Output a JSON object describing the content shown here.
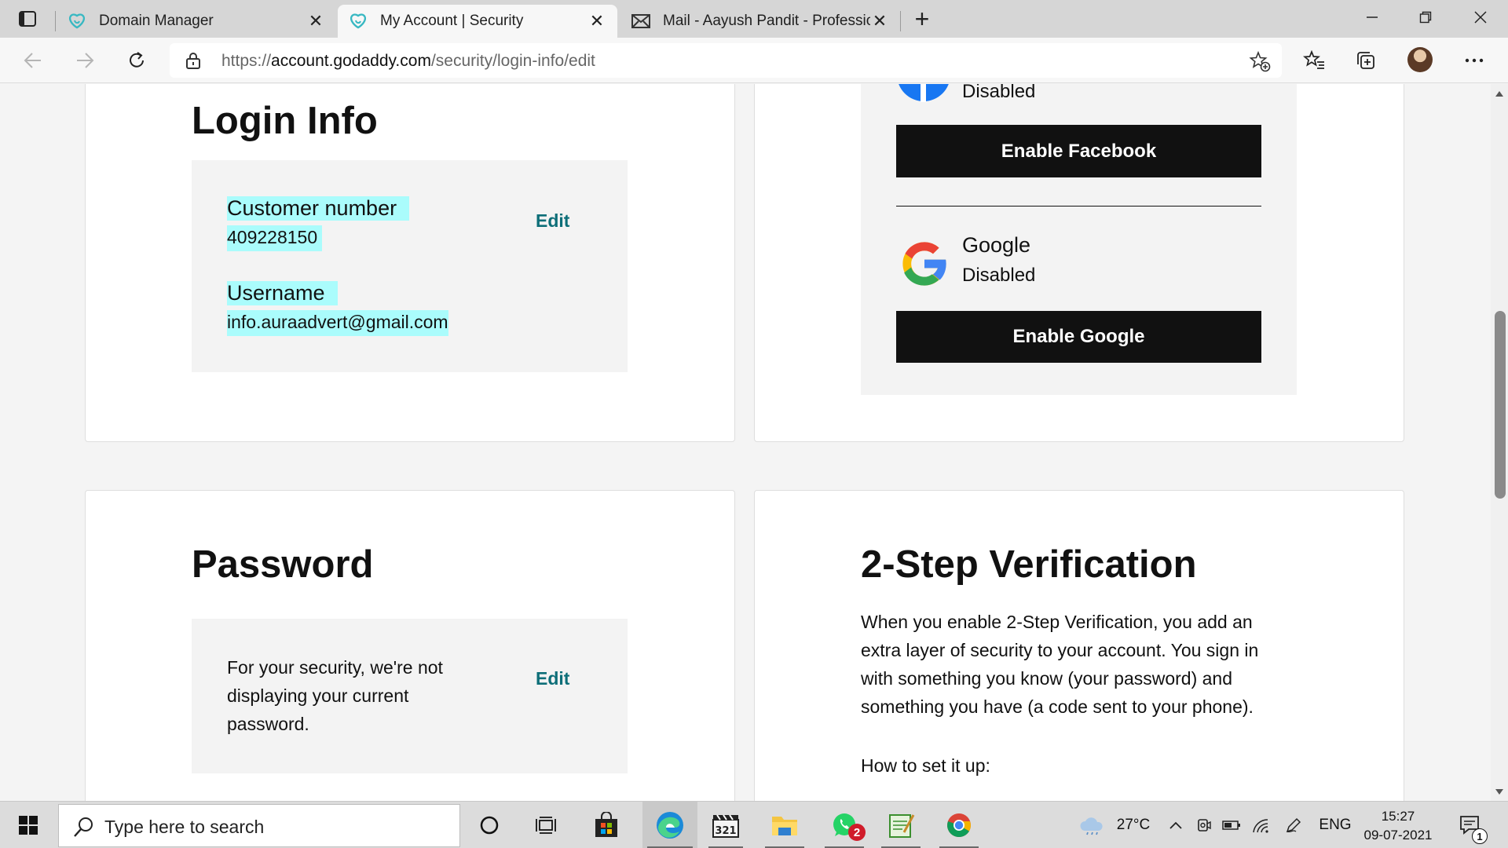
{
  "browser": {
    "tabs": [
      {
        "title": "Domain Manager",
        "active": false,
        "favicon": "godaddy-icon"
      },
      {
        "title": "My Account | Security",
        "active": true,
        "favicon": "godaddy-icon"
      },
      {
        "title": "Mail - Aayush Pandit - Profession",
        "active": false,
        "favicon": "mail-icon"
      }
    ],
    "close_glyph": "✕",
    "new_tab_glyph": "+",
    "url": {
      "prefix": "https://",
      "host": "account.godaddy.com",
      "path": "/security/login-info/edit"
    }
  },
  "login_info": {
    "title": "Login Info",
    "customer_number_label": "Customer number",
    "customer_number": "409228150",
    "username_label": "Username",
    "username": "info.auraadvert@gmail.com",
    "edit_label": "Edit"
  },
  "social_login": {
    "facebook": {
      "status": "Disabled",
      "button_label": "Enable Facebook"
    },
    "google": {
      "name": "Google",
      "status": "Disabled",
      "button_label": "Enable Google"
    }
  },
  "password": {
    "title": "Password",
    "message": "For your security, we're not displaying your current password.",
    "edit_label": "Edit"
  },
  "two_step": {
    "title": "2-Step Verification",
    "description": "When you enable 2-Step Verification, you add an extra layer of security to your account. You sign in with something you know (your password) and something you have (a code sent to your phone).",
    "how_to": "How to set it up:"
  },
  "taskbar": {
    "search_placeholder": "Type here to search",
    "whatsapp_badge": "2",
    "weather": "27°C",
    "language": "ENG",
    "time": "15:27",
    "date": "09-07-2021",
    "notification_count": "1"
  },
  "colors": {
    "highlight": "#aafcfc",
    "edit_link": "#0d6e78",
    "button_bg": "#111111",
    "panel_bg": "#f3f3f3"
  }
}
